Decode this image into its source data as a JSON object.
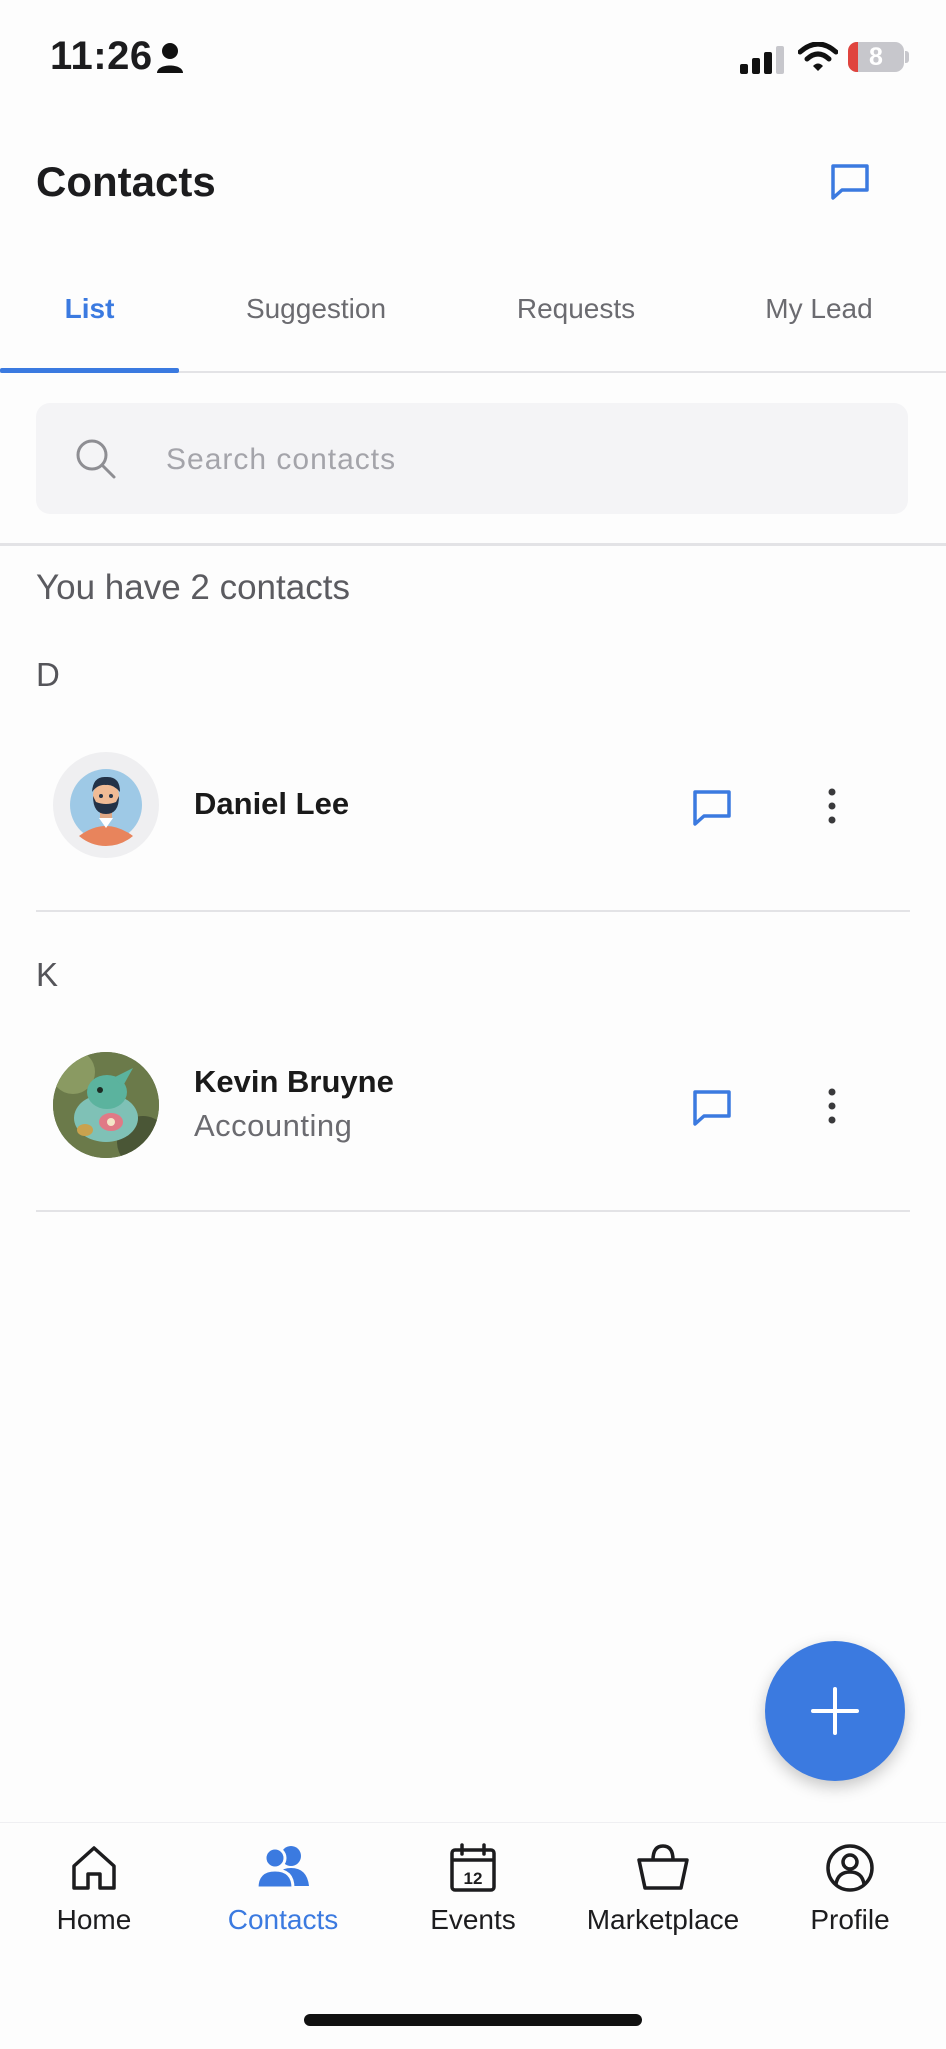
{
  "status_bar": {
    "time": "11:26",
    "battery": "8"
  },
  "header": {
    "title": "Contacts"
  },
  "tabs": [
    {
      "label": "List",
      "active": true
    },
    {
      "label": "Suggestion",
      "active": false
    },
    {
      "label": "Requests",
      "active": false
    },
    {
      "label": "My Lead",
      "active": false
    }
  ],
  "search": {
    "placeholder": "Search contacts",
    "value": ""
  },
  "contacts_count": "You have 2 contacts",
  "sections": [
    {
      "letter": "D",
      "contacts": [
        {
          "name": "Daniel Lee",
          "subtitle": ""
        }
      ]
    },
    {
      "letter": "K",
      "contacts": [
        {
          "name": "Kevin Bruyne",
          "subtitle": "Accounting"
        }
      ]
    }
  ],
  "bottom_nav": [
    {
      "label": "Home",
      "icon": "home-icon",
      "active": false
    },
    {
      "label": "Contacts",
      "icon": "contacts-icon",
      "active": true
    },
    {
      "label": "Events",
      "icon": "calendar-icon",
      "active": false,
      "badge": "12"
    },
    {
      "label": "Marketplace",
      "icon": "bag-icon",
      "active": false
    },
    {
      "label": "Profile",
      "icon": "profile-icon",
      "active": false
    }
  ],
  "colors": {
    "accent": "#3b7ae0",
    "text": "#1c1c1e",
    "muted": "#6b6b70",
    "divider": "#e3e3e6"
  }
}
